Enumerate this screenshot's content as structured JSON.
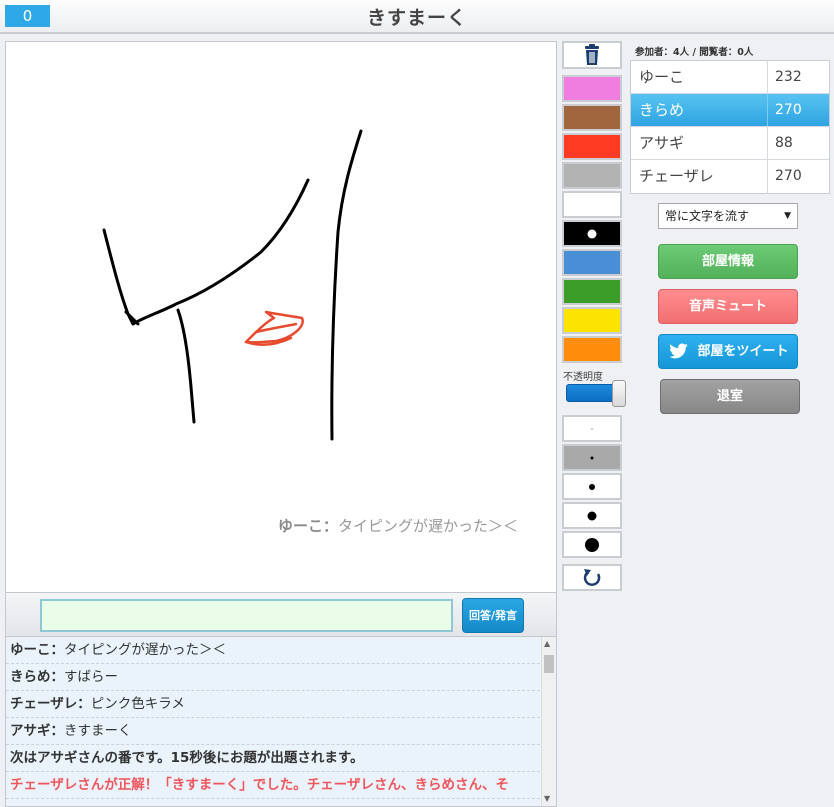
{
  "header": {
    "timer": "0",
    "title": "きすまーく"
  },
  "canvas": {
    "overlay_name": "ゆーこ：",
    "overlay_text": "タイピングが遅かった＞＜"
  },
  "input": {
    "value": "",
    "button_label": "回答/発言"
  },
  "chat": [
    {
      "name": "ゆーこ：",
      "text": "タイピングが遅かった＞＜",
      "kind": "msg"
    },
    {
      "name": "きらめ：",
      "text": "すばらー",
      "kind": "msg"
    },
    {
      "name": "チェーザレ：",
      "text": "ピンク色キラメ",
      "kind": "msg"
    },
    {
      "name": "アサギ：",
      "text": "きすまーく",
      "kind": "msg"
    },
    {
      "name": "",
      "text": "次はアサギさんの番です。15秒後にお題が出題されます。",
      "kind": "sys"
    },
    {
      "name": "",
      "text": "チェーザレさんが正解！「きすまーく」でした。チェーザレさん、きらめさん、そ",
      "kind": "win"
    }
  ],
  "palette": {
    "colors": [
      "#f07ee0",
      "#a0673e",
      "#ff3a22",
      "#b3b3b3",
      "#ffffff",
      "#000000",
      "#4a8fd6",
      "#3c9c28",
      "#fde300",
      "#ff8c0a"
    ],
    "selected_color": "#000000",
    "opacity_label": "不透明度",
    "opacity": 1.0,
    "pen_sizes": [
      1,
      3,
      6,
      9,
      14
    ],
    "selected_size": 3,
    "icons": {
      "clear": "trash-icon",
      "undo": "undo-icon"
    }
  },
  "room": {
    "participants_label": "参加者：",
    "participants": "4人",
    "separator": " / ",
    "viewers_label": "閲覧者：",
    "viewers": "0人"
  },
  "players": [
    {
      "name": "ゆーこ",
      "score": "232",
      "active": false
    },
    {
      "name": "きらめ",
      "score": "270",
      "active": true
    },
    {
      "name": "アサギ",
      "score": "88",
      "active": false
    },
    {
      "name": "チェーザレ",
      "score": "270",
      "active": false
    }
  ],
  "select": {
    "value": "常に文字を流す",
    "caret": "▼"
  },
  "buttons": {
    "room_info": "部屋情報",
    "mute": "音声ミュート",
    "tweet": "部屋をツイート",
    "leave": "退室"
  }
}
